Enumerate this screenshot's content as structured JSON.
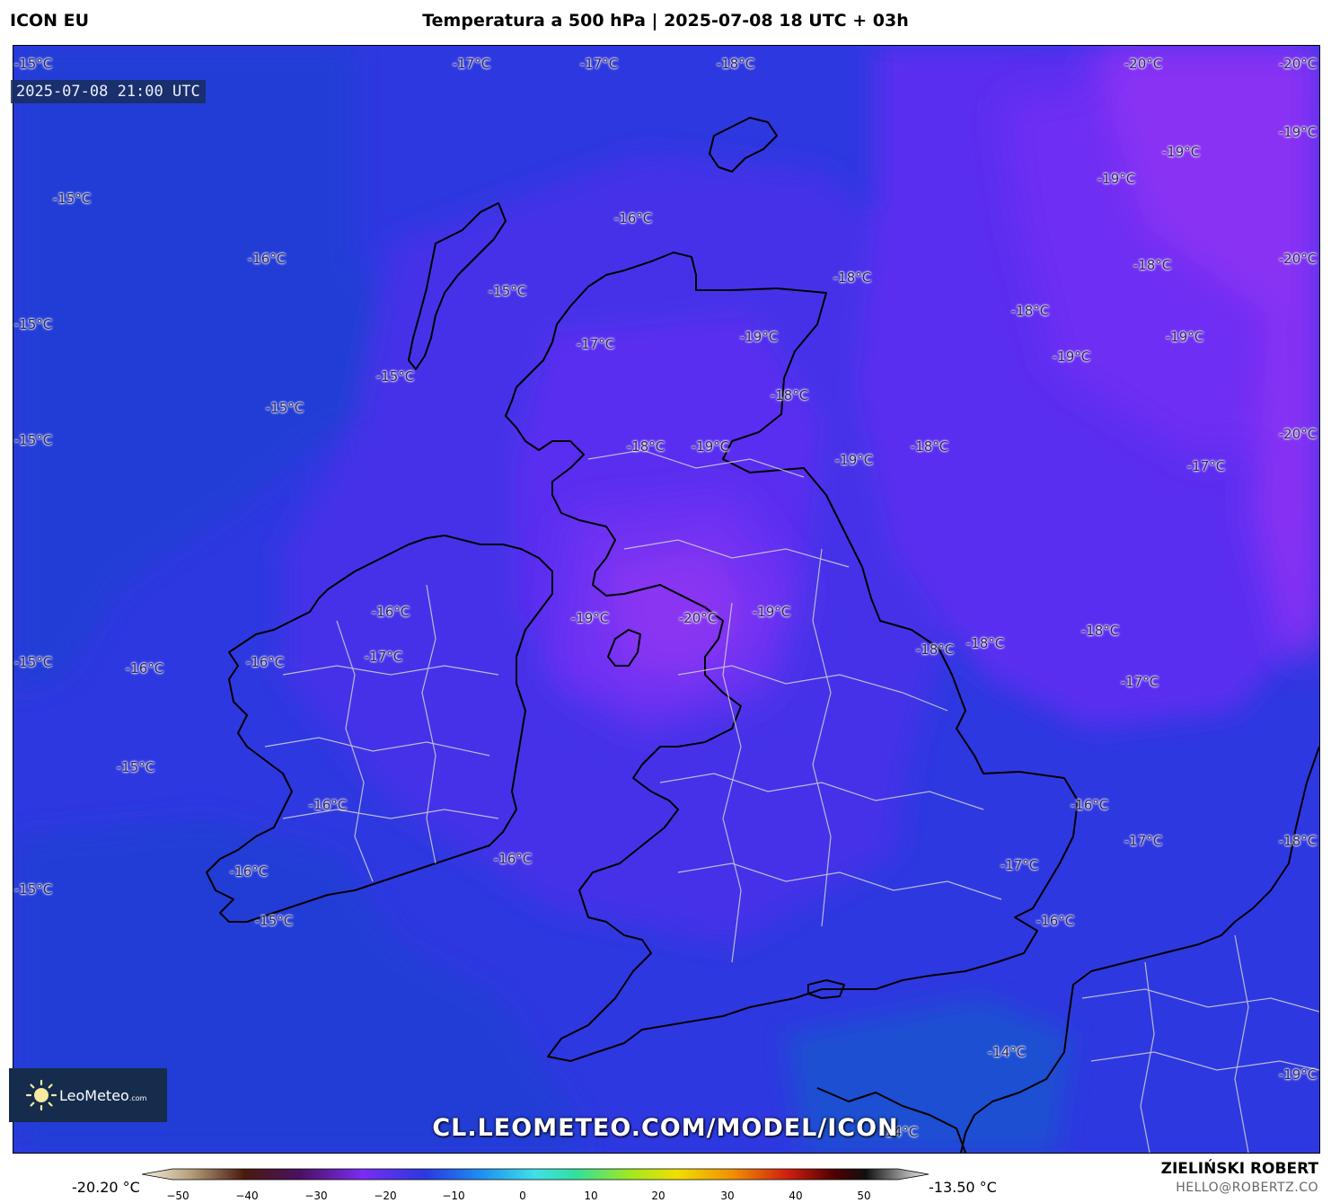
{
  "header": {
    "model": "ICON EU",
    "title": "Temperatura a 500 hPa | 2025-07-08 18 UTC + 03h"
  },
  "map": {
    "valid_time": "2025-07-08 21:00 UTC",
    "region": "British Isles",
    "field_colors": {
      "minus_14": "#1f50d2",
      "minus_15": "#213ed6",
      "minus_16": "#2e38e0",
      "minus_17": "#4430e8",
      "minus_18": "#5a2ef0",
      "minus_19": "#6e2ef3",
      "minus_20": "#8830f4"
    },
    "labels": [
      {
        "text": "-15°C"
      },
      {
        "text": "-17°C"
      },
      {
        "text": "-17°C"
      },
      {
        "text": "-18°C"
      },
      {
        "text": "-20°C"
      },
      {
        "text": "-20°C"
      },
      {
        "text": "-19°C"
      },
      {
        "text": "-19°C"
      },
      {
        "text": "-19°C"
      },
      {
        "text": "-15°C"
      },
      {
        "text": "-16°C"
      },
      {
        "text": "-16°C"
      },
      {
        "text": "-18°C"
      },
      {
        "text": "-18°C"
      },
      {
        "text": "-20°C"
      },
      {
        "text": "-15°C"
      },
      {
        "text": "-15°C"
      },
      {
        "text": "-18°C"
      },
      {
        "text": "-17°C"
      },
      {
        "text": "-19°C"
      },
      {
        "text": "-19°C"
      },
      {
        "text": "-19°C"
      },
      {
        "text": "-15°C"
      },
      {
        "text": "-15°C"
      },
      {
        "text": "-18°C"
      },
      {
        "text": "-15°C"
      },
      {
        "text": "-18°C"
      },
      {
        "text": "-19°C"
      },
      {
        "text": "-19°C"
      },
      {
        "text": "-18°C"
      },
      {
        "text": "-20°C"
      },
      {
        "text": "-17°C"
      },
      {
        "text": "-16°C"
      },
      {
        "text": "-19°C"
      },
      {
        "text": "-20°C"
      },
      {
        "text": "-19°C"
      },
      {
        "text": "-18°C"
      },
      {
        "text": "-18°C"
      },
      {
        "text": "-18°C"
      },
      {
        "text": "-17°C"
      },
      {
        "text": "-16°C"
      },
      {
        "text": "-17°C"
      },
      {
        "text": "-15°C"
      },
      {
        "text": "-16°C"
      },
      {
        "text": "-15°C"
      },
      {
        "text": "-16°C"
      },
      {
        "text": "-16°C"
      },
      {
        "text": "-16°C"
      },
      {
        "text": "-16°C"
      },
      {
        "text": "-17°C"
      },
      {
        "text": "-17°C"
      },
      {
        "text": "-18°C"
      },
      {
        "text": "-15°C"
      },
      {
        "text": "-16°C"
      },
      {
        "text": "-14°C"
      },
      {
        "text": "-14°C"
      },
      {
        "text": "-19°C"
      },
      {
        "text": "-15°C"
      }
    ]
  },
  "branding": {
    "logo_text": "LeoMeteo",
    "logo_suffix": ".com",
    "url": "CL.LEOMETEO.COM/MODEL/ICON"
  },
  "colorbar": {
    "min_label": "-20.20 °C",
    "max_label": "-13.50 °C",
    "ticks": [
      "−50",
      "−40",
      "−30",
      "−20",
      "−10",
      "0",
      "10",
      "20",
      "30",
      "40",
      "50"
    ]
  },
  "footer": {
    "author": "ZIELIŃSKI ROBERT",
    "contact": "HELLO@ROBERTZ.CO"
  }
}
